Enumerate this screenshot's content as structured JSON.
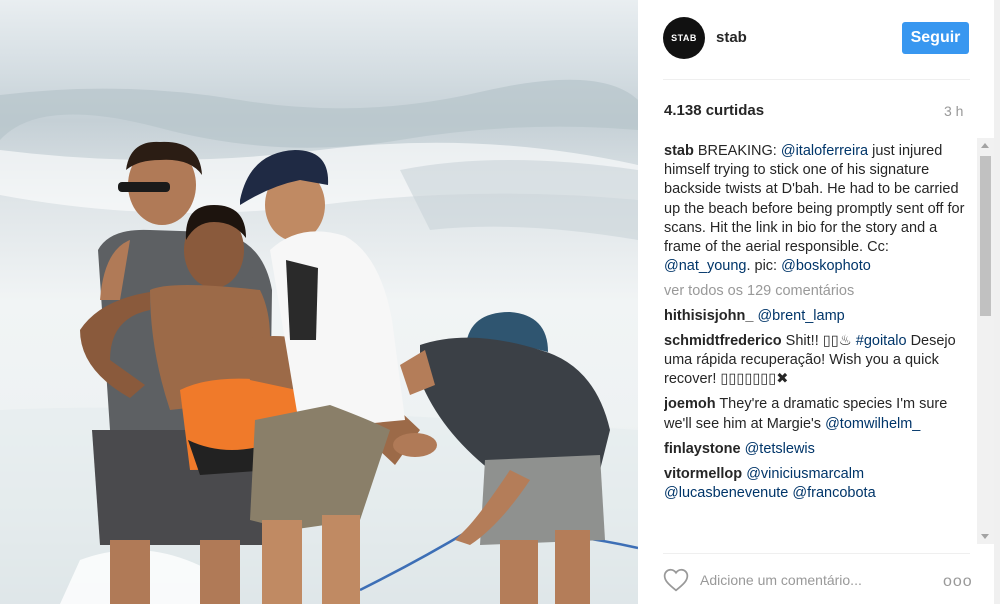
{
  "post": {
    "username": "stab",
    "avatar_text": "STAB",
    "follow_label": "Seguir",
    "likes": "4.138 curtidas",
    "time": "3 h"
  },
  "caption": {
    "user": "stab",
    "t1": " BREAKING: ",
    "m1": "@italoferreira",
    "t2": " just injured himself trying to stick one of his signature backside twists at D'bah. He had to be carried up the beach before being promptly sent off for scans. Hit the link in bio for the story and a frame of the aerial responsible. Cc: ",
    "m2": "@nat_young",
    "t3": ". pic: ",
    "m3": "@boskophoto"
  },
  "see_all": "ver todos os 129 comentários",
  "comments": {
    "c1": {
      "user": "hithisisjohn_",
      "m1": "@brent_lamp"
    },
    "c2": {
      "user": "schmidtfrederico",
      "t1": " Shit!! ▯▯♨ ",
      "m1": "#goitalo",
      "t2": " Desejo uma rápida recuperação! Wish you a quick recover! ▯▯▯▯▯▯▯✖"
    },
    "c3": {
      "user": "joemoh",
      "t1": " They're a dramatic species I'm sure we'll see him at Margie's ",
      "m1": "@tomwilhelm_"
    },
    "c4": {
      "user": "finlaystone",
      "m1": "@tetslewis"
    },
    "c5": {
      "user": "vitormellop",
      "m1": "@viniciusmarcalm",
      "m2": "@lucasbenevenute",
      "m3": "@francobota"
    }
  },
  "add_comment_placeholder": "Adicione um comentário...",
  "more_label": "ooo",
  "icons": {
    "like": "heart-outline-icon",
    "more": "more-options-icon"
  },
  "colors": {
    "follow_button": "#3897f0",
    "mention": "#003569",
    "muted": "#999999"
  }
}
